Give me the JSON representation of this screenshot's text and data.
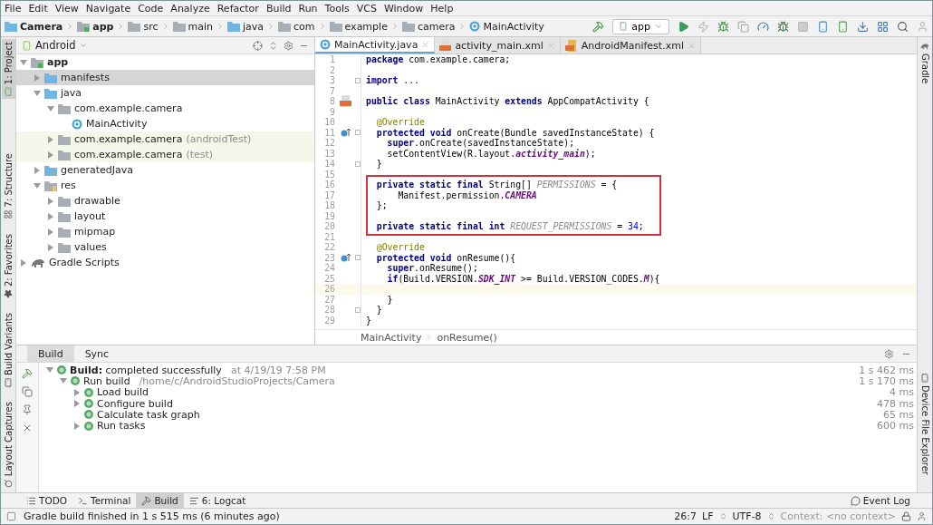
{
  "menu": [
    "File",
    "Edit",
    "View",
    "Navigate",
    "Code",
    "Analyze",
    "Refactor",
    "Build",
    "Run",
    "Tools",
    "VCS",
    "Window",
    "Help"
  ],
  "breadcrumb": [
    {
      "label": "Camera",
      "kind": "project"
    },
    {
      "label": "app",
      "kind": "module"
    },
    {
      "label": "src",
      "kind": "folder"
    },
    {
      "label": "main",
      "kind": "folder"
    },
    {
      "label": "java",
      "kind": "source"
    },
    {
      "label": "com",
      "kind": "folder"
    },
    {
      "label": "example",
      "kind": "folder"
    },
    {
      "label": "camera",
      "kind": "folder"
    },
    {
      "label": "MainActivity",
      "kind": "class"
    }
  ],
  "run_config": "app",
  "left_strip": [
    {
      "label": "1: Project",
      "selected": true
    },
    {
      "label": "7: Structure",
      "selected": false
    },
    {
      "label": "2: Favorites",
      "selected": false
    },
    {
      "label": "Build Variants",
      "selected": false
    },
    {
      "label": "Layout Captures",
      "selected": false
    }
  ],
  "right_strip": [
    "Gradle",
    "Device File Explorer"
  ],
  "project_panel": {
    "view": "Android",
    "tree": [
      {
        "label": "app",
        "kind": "module",
        "expanded": true,
        "selected": false,
        "children": [
          {
            "label": "manifests",
            "kind": "source",
            "expanded": false,
            "selected": true
          },
          {
            "label": "java",
            "kind": "source",
            "expanded": true,
            "selected": false,
            "children": [
              {
                "label": "com.example.camera",
                "kind": "folder",
                "expanded": true,
                "selected": false,
                "test": false,
                "children": [
                  {
                    "label": "MainActivity",
                    "kind": "class",
                    "selected": false
                  }
                ]
              },
              {
                "label": "com.example.camera",
                "suffix": "(androidTest)",
                "kind": "folder",
                "expanded": false,
                "selected": false,
                "test": true
              },
              {
                "label": "com.example.camera",
                "suffix": "(test)",
                "kind": "folder",
                "expanded": false,
                "selected": false,
                "test": true
              }
            ]
          },
          {
            "label": "generatedJava",
            "kind": "generated",
            "expanded": false,
            "selected": false
          },
          {
            "label": "res",
            "kind": "res",
            "expanded": true,
            "selected": false,
            "children": [
              {
                "label": "drawable",
                "kind": "folder",
                "expanded": false,
                "selected": false
              },
              {
                "label": "layout",
                "kind": "folder",
                "expanded": false,
                "selected": false
              },
              {
                "label": "mipmap",
                "kind": "folder",
                "expanded": false,
                "selected": false
              },
              {
                "label": "values",
                "kind": "folder",
                "expanded": false,
                "selected": false
              }
            ]
          }
        ]
      },
      {
        "label": "Gradle Scripts",
        "kind": "gradle",
        "expanded": false,
        "selected": false
      }
    ]
  },
  "editor_tabs": [
    {
      "label": "MainActivity.java",
      "kind": "class",
      "selected": true
    },
    {
      "label": "activity_main.xml",
      "kind": "xml",
      "selected": false
    },
    {
      "label": "AndroidManifest.xml",
      "kind": "manifest",
      "selected": false
    }
  ],
  "code_lines": [
    {
      "number": "1",
      "tokens": [
        {
          "text": "package",
          "kind": "kw"
        },
        {
          "text": " com.example.camera;",
          "kind": "plain"
        }
      ]
    },
    {
      "number": "2"
    },
    {
      "number": "3",
      "fold": true,
      "tokens": [
        {
          "text": "import",
          "kind": "kw"
        },
        {
          "text": " ...",
          "kind": "plain"
        }
      ]
    },
    {
      "number": "7"
    },
    {
      "number": "8",
      "marker": {
        "kind": "xml"
      },
      "tokens": [
        {
          "text": "public class",
          "kind": "kw"
        },
        {
          "text": " MainActivity ",
          "kind": "plain"
        },
        {
          "text": "extends",
          "kind": "kw"
        },
        {
          "text": " AppCompatActivity {",
          "kind": "plain"
        }
      ]
    },
    {
      "number": "9"
    },
    {
      "number": "10",
      "tokens": [
        {
          "text": "  @Override",
          "kind": "ann"
        }
      ]
    },
    {
      "number": "11",
      "marker": {
        "kind": "override"
      },
      "fold": true,
      "tokens": [
        {
          "text": "  protected void",
          "kind": "kw"
        },
        {
          "text": " onCreate(Bundle savedInstanceState) {",
          "kind": "plain"
        }
      ]
    },
    {
      "number": "12",
      "tokens": [
        {
          "text": "    super",
          "kind": "kw"
        },
        {
          "text": ".onCreate(savedInstanceState);",
          "kind": "plain"
        }
      ]
    },
    {
      "number": "13",
      "tokens": [
        {
          "text": "    setContentView(R.layout.",
          "kind": "plain"
        },
        {
          "text": "activity_main",
          "kind": "const"
        },
        {
          "text": ");",
          "kind": "plain"
        }
      ]
    },
    {
      "number": "14",
      "fold": true,
      "tokens": [
        {
          "text": "  }",
          "kind": "plain"
        }
      ]
    },
    {
      "number": "15"
    },
    {
      "number": "16",
      "boxed": true,
      "tokens": [
        {
          "text": "  private static final",
          "kind": "kw"
        },
        {
          "text": " String[] ",
          "kind": "plain"
        },
        {
          "text": "PERMISSIONS",
          "kind": "unused"
        },
        {
          "text": " = {",
          "kind": "plain"
        }
      ]
    },
    {
      "number": "17",
      "boxed": true,
      "tokens": [
        {
          "text": "      Manifest.permission.",
          "kind": "plain"
        },
        {
          "text": "CAMERA",
          "kind": "const"
        }
      ]
    },
    {
      "number": "18",
      "boxed": true,
      "tokens": [
        {
          "text": "  };",
          "kind": "plain"
        }
      ]
    },
    {
      "number": "19",
      "boxed": true
    },
    {
      "number": "20",
      "boxed": true,
      "tokens": [
        {
          "text": "  private static final int ",
          "kind": "kw"
        },
        {
          "text": "REQUEST_PERMISSIONS",
          "kind": "unused"
        },
        {
          "text": " = ",
          "kind": "plain"
        },
        {
          "text": "34",
          "kind": "num"
        },
        {
          "text": ";",
          "kind": "plain"
        }
      ]
    },
    {
      "number": "21"
    },
    {
      "number": "22",
      "tokens": [
        {
          "text": "  @Override",
          "kind": "ann"
        }
      ]
    },
    {
      "number": "23",
      "marker": {
        "kind": "override"
      },
      "fold": true,
      "tokens": [
        {
          "text": "  protected void",
          "kind": "kw"
        },
        {
          "text": " onResume(){",
          "kind": "plain"
        }
      ]
    },
    {
      "number": "24",
      "tokens": [
        {
          "text": "    super",
          "kind": "kw"
        },
        {
          "text": ".onResume();",
          "kind": "plain"
        }
      ]
    },
    {
      "number": "25",
      "tokens": [
        {
          "text": "    if",
          "kind": "kw"
        },
        {
          "text": "(Build.VERSION.",
          "kind": "plain"
        },
        {
          "text": "SDK_INT",
          "kind": "const"
        },
        {
          "text": " >= Build.VERSION_CODES.",
          "kind": "plain"
        },
        {
          "text": "M",
          "kind": "const"
        },
        {
          "text": "){",
          "kind": "plain"
        }
      ]
    },
    {
      "number": "26",
      "current": true
    },
    {
      "number": "27",
      "tokens": [
        {
          "text": "    }",
          "kind": "plain"
        }
      ]
    },
    {
      "number": "28",
      "fold": true,
      "tokens": [
        {
          "text": "  }",
          "kind": "plain"
        }
      ]
    },
    {
      "number": "29",
      "tokens": [
        {
          "text": "}",
          "kind": "plain"
        }
      ]
    }
  ],
  "editor_breadcrumb": [
    "MainActivity",
    "onResume()"
  ],
  "build_panel": {
    "tabs": [
      {
        "label": "Build",
        "selected": true
      },
      {
        "label": "Sync",
        "selected": false
      }
    ],
    "tree": [
      {
        "label": "**Build:** completed successfully",
        "detail": "at 4/19/19 7:58 PM",
        "time": "1 s 462 ms",
        "expanded": true,
        "children": [
          {
            "label": "Run build",
            "detail": "/home/c/AndroidStudioProjects/Camera",
            "time": "1 s 170 ms",
            "expanded": true,
            "children": [
              {
                "label": "Load build",
                "time": "4 ms",
                "expanded": false
              },
              {
                "label": "Configure build",
                "time": "478 ms",
                "expanded": false
              },
              {
                "label": "Calculate task graph",
                "time": "65 ms"
              },
              {
                "label": "Run tasks",
                "time": "600 ms",
                "expanded": false
              }
            ]
          }
        ]
      }
    ]
  },
  "tool_tabs": [
    {
      "label": "TODO",
      "selected": false
    },
    {
      "label": "Terminal",
      "selected": false
    },
    {
      "label": "Build",
      "selected": true
    },
    {
      "label": "6: Logcat",
      "selected": false
    }
  ],
  "event_log": "Event Log",
  "status_bar": {
    "message": "Gradle build finished in 1 s 515 ms (6 minutes ago)",
    "position": "26:7",
    "line_separator": "LF",
    "encoding": "UTF-8",
    "context": "Context: <no context>"
  }
}
